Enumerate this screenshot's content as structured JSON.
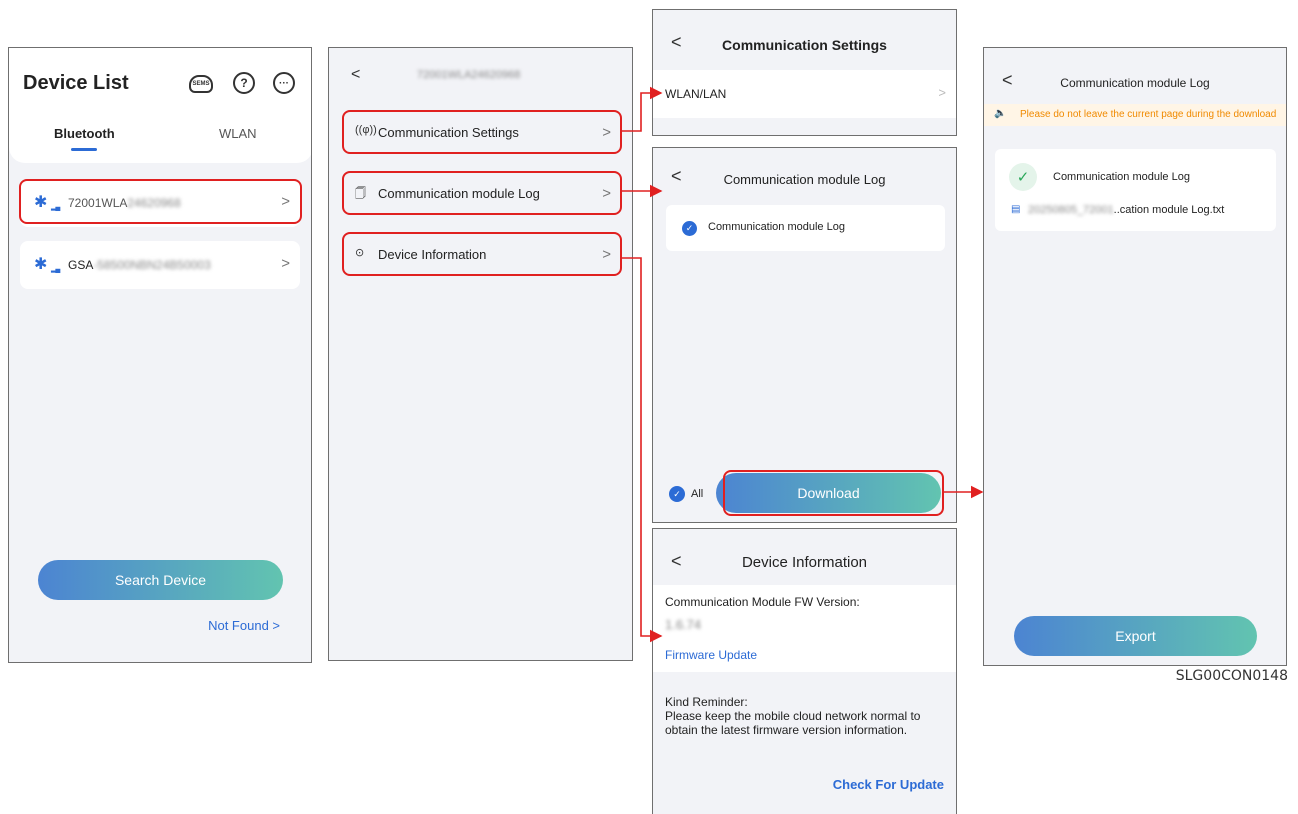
{
  "screen1": {
    "title": "Device List",
    "cloud_icon_text": "SEMS",
    "help_icon": "question-circle-icon",
    "more_icon": "ellipsis-circle-icon",
    "tabs": [
      "Bluetooth",
      "WLAN"
    ],
    "active_tab": "Bluetooth",
    "devices": [
      {
        "prefix": "72001WLA",
        "suffix": "24620968"
      },
      {
        "prefix": "GSA",
        "suffix": "-58500NBN24B50003"
      }
    ],
    "search_button": "Search Device",
    "not_found_link": "Not Found >"
  },
  "screen2": {
    "device_title": "72001WLA24620968",
    "menu": [
      {
        "icon": "antenna-icon",
        "icon_glyph": "((φ))",
        "label": "Communication Settings"
      },
      {
        "icon": "log-file-icon",
        "icon_glyph": "🗍",
        "label": "Communication module Log"
      },
      {
        "icon": "info-icon",
        "icon_glyph": "⊙",
        "label": "Device Information"
      }
    ]
  },
  "screen3": {
    "title": "Communication Settings",
    "row_label": "WLAN/LAN"
  },
  "screen4": {
    "title": "Communication module Log",
    "item_label": "Communication module Log",
    "all_label": "All",
    "download_button": "Download"
  },
  "screen5": {
    "title": "Device Information",
    "fw_label": "Communication Module FW Version:",
    "fw_version": "1.6.74",
    "fw_update_link": "Firmware Update",
    "reminder_title": "Kind Reminder:",
    "reminder_text": "Please keep the mobile cloud network normal to obtain the latest firmware version information.",
    "check_update": "Check For Update"
  },
  "screen6": {
    "title": "Communication module Log",
    "banner": "Please do not leave the current page during the download",
    "item_label": "Communication module Log",
    "file_prefix": "20250805_72001",
    "file_suffix": "..cation module Log.txt",
    "export_button": "Export"
  },
  "caption": "SLG00CON0148",
  "colors": {
    "accent_blue": "#2c6bd5",
    "highlight_red": "#e02020",
    "gradient_start": "#4c84d2",
    "gradient_end": "#62c4b0",
    "warning_orange": "#f08a00"
  }
}
